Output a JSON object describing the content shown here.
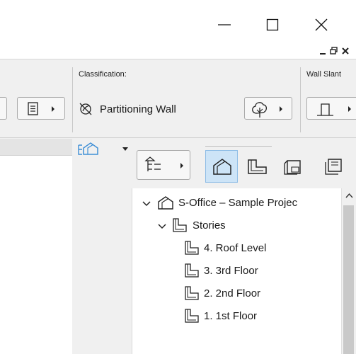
{
  "window_controls": {
    "minimize": "minimize",
    "maximize": "maximize",
    "close": "close"
  },
  "doc_controls": {
    "restore": "restore",
    "close": "close"
  },
  "info_box": {
    "classification_label": "Classification:",
    "classification_value": "Partitioning Wall",
    "wall_slant_label": "Wall Slant"
  },
  "navigator": {
    "tabs": [
      "project-map",
      "view-map",
      "layout-book",
      "publisher-sets"
    ],
    "active_tab": "project-map",
    "project": {
      "label": "S-Office – Sample Projec",
      "expanded": true
    },
    "stories": {
      "label": "Stories",
      "expanded": true,
      "items": [
        "4. Roof Level",
        "3. 3rd Floor",
        "2. 2nd Floor",
        "1. 1st Floor"
      ]
    }
  },
  "icons": {
    "classification": "leaf-slash-icon",
    "tree_classification": "tree-classification-icon",
    "wall_slant": "wall-slant-icon",
    "project_map": "house-icon",
    "view_map": "story-icon"
  }
}
